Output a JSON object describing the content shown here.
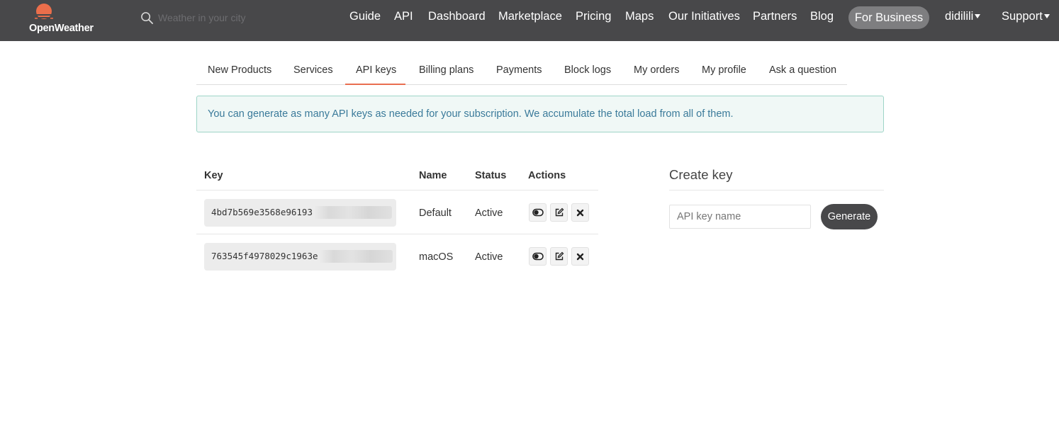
{
  "brand": {
    "name": "OpenWeather",
    "logo_color": "#eb6e4b"
  },
  "search": {
    "placeholder": "Weather in your city"
  },
  "nav": {
    "items": [
      "Guide",
      "API",
      "Dashboard",
      "Marketplace",
      "Pricing",
      "Maps",
      "Our Initiatives",
      "Partners",
      "Blog"
    ],
    "business": "For Business",
    "user": "didilili",
    "support": "Support"
  },
  "tabs": {
    "items": [
      "New Products",
      "Services",
      "API keys",
      "Billing plans",
      "Payments",
      "Block logs",
      "My orders",
      "My profile",
      "Ask a question"
    ],
    "active": "API keys"
  },
  "alert": {
    "text": "You can generate as many API keys as needed for your subscription. We accumulate the total load from all of them."
  },
  "table": {
    "headers": [
      "Key",
      "Name",
      "Status",
      "Actions"
    ],
    "rows": [
      {
        "key": "4bd7b569e3568e96193",
        "name": "Default",
        "status": "Active"
      },
      {
        "key": "763545f4978029c1963e",
        "name": "macOS",
        "status": "Active"
      }
    ],
    "actions": [
      "toggle-icon",
      "edit-icon",
      "delete-icon"
    ]
  },
  "create": {
    "title": "Create key",
    "placeholder": "API key name",
    "button": "Generate"
  },
  "colors": {
    "navbar": "#48484a",
    "accent": "#e96e50",
    "alert_bg": "#f0f8f6",
    "alert_text": "#3a7a9a"
  }
}
